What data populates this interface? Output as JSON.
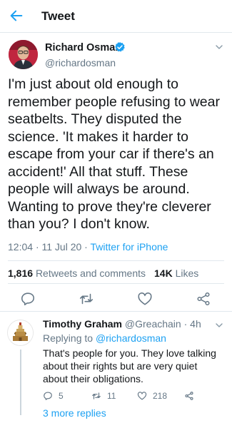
{
  "header": {
    "title": "Tweet",
    "back_icon": "arrow-left-icon"
  },
  "tweet": {
    "author_name": "Richard Osman",
    "author_handle": "@richardosman",
    "text": "I'm just about old enough to remember people refusing to wear seatbelts. They disputed the science. 'It makes it harder to escape from your car if there's an accident!' All that stuff. These people will always be around. Wanting to prove they're cleverer than you? I don't know.",
    "time": "12:04",
    "date": "11 Jul 20",
    "source": "Twitter for iPhone",
    "retweets_count": "1,816",
    "retweets_label": "Retweets and comments",
    "likes_count": "14K",
    "likes_label": "Likes",
    "actions": [
      "reply-icon",
      "retweet-icon",
      "like-icon",
      "share-icon"
    ]
  },
  "reply": {
    "author_name": "Timothy Graham",
    "author_handle": "@Greachain",
    "time": "4h",
    "replying_label": "Replying to",
    "replying_to": "@richardosman",
    "text": "That's people for you. They love talking about their rights but are very quiet about their obligations.",
    "reply_count": "5",
    "retweet_count": "11",
    "like_count": "218",
    "more_replies": "3 more replies"
  },
  "colors": {
    "accent": "#1da1f2",
    "secondary_text": "#657786",
    "divider": "#e1e8ed"
  }
}
